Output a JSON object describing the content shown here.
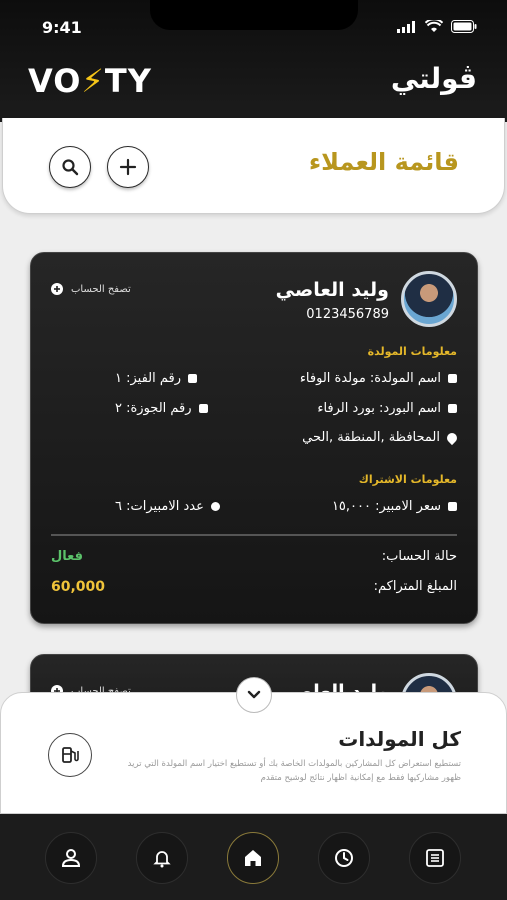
{
  "status_bar": {
    "time": "9:41"
  },
  "header": {
    "logo_left": "VO",
    "logo_bolt": "⚡",
    "logo_right": "TY",
    "app_title": "ڤولتي"
  },
  "page": {
    "title": "قائمة العملاء"
  },
  "customers": [
    {
      "name": "وليد العاصي",
      "phone": "0123456789",
      "browse_label": "تصفح الحساب",
      "generator_section": "معلومات المولدة",
      "generator_name": "اسم المولدة: مولدة الوفاء",
      "board_name": "اسم البورد: بورد الرفاء",
      "location": "المحافظة ,المنطقة ,الحي",
      "phase_number": "رقم الفيز: ١",
      "device_number": "رقم الجوزة: ٢",
      "subscription_section": "معلومات الاشتراك",
      "ampere_price": "سعر الامبير: ١٥,٠٠٠",
      "ampere_count": "عدد الامبيرات: ٦",
      "status_label": "حالة الحساب:",
      "status_value": "فعال",
      "accumulated_label": "المبلغ المتراكم:",
      "accumulated_value": "60,000"
    },
    {
      "name": "وليد العاصي",
      "browse_label": "تصفح الحساب"
    }
  ],
  "sheet": {
    "title": "كل المولدات",
    "description": "تستطيع استعراض كل المشاركين بالمولدات الخاصة بك أو تستطيع اختيار اسم المولدة التي تريد ظهور مشاركيها فقط مع إمكانية اظهار نتائج لوشيح متقدم"
  },
  "nav": {
    "items": [
      "user-icon",
      "bell-icon",
      "home-icon",
      "clock-icon",
      "list-icon"
    ],
    "active": "home-icon"
  },
  "colors": {
    "accent_gold": "#b8961e",
    "amount_gold": "#f0c43a",
    "status_green": "#5bc26a"
  }
}
